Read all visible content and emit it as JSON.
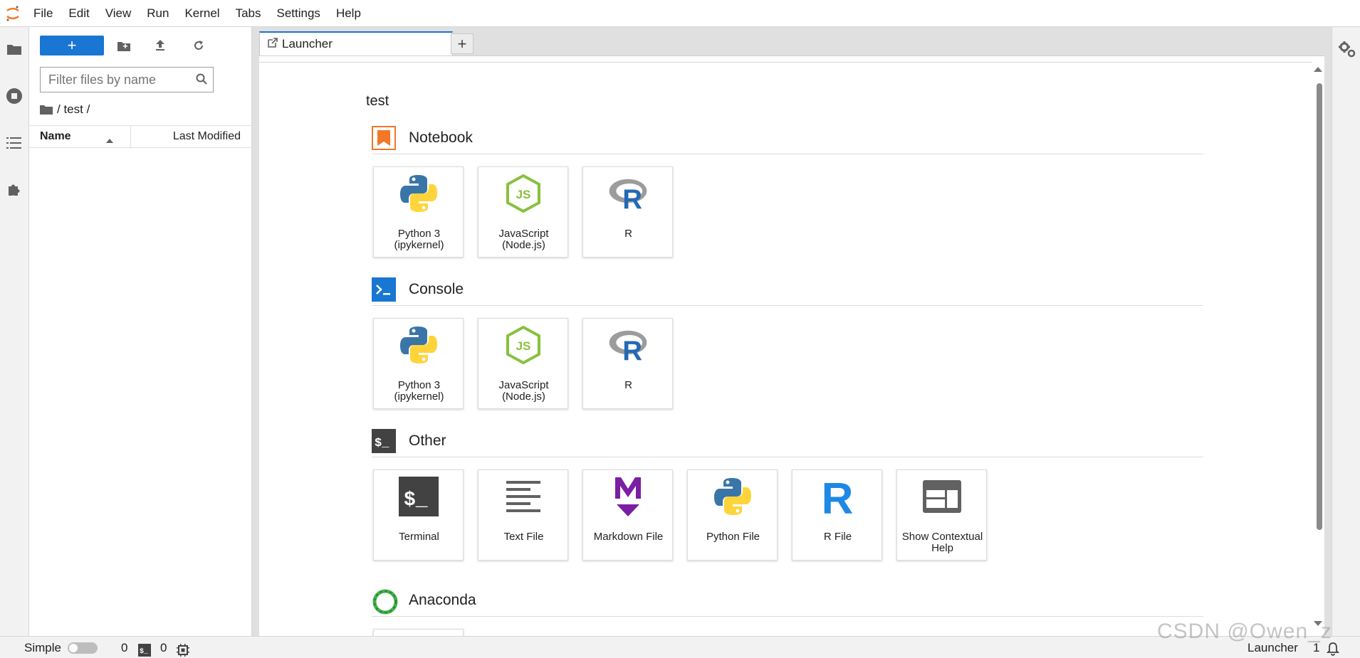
{
  "menubar": {
    "items": [
      "File",
      "Edit",
      "View",
      "Run",
      "Kernel",
      "Tabs",
      "Settings",
      "Help"
    ]
  },
  "filebrowser": {
    "new_label": "+",
    "filter_placeholder": "Filter files by name",
    "breadcrumb": "/ test /",
    "columns": {
      "name": "Name",
      "modified": "Last Modified"
    }
  },
  "tabs": [
    {
      "label": "Launcher"
    }
  ],
  "add_tab_label": "+",
  "launcher": {
    "cwd": "test",
    "sections": [
      {
        "title": "Notebook",
        "items": [
          "Python 3 (ipykernel)",
          "JavaScript (Node.js)",
          "R"
        ]
      },
      {
        "title": "Console",
        "items": [
          "Python 3 (ipykernel)",
          "JavaScript (Node.js)",
          "R"
        ]
      },
      {
        "title": "Other",
        "items": [
          "Terminal",
          "Text File",
          "Markdown File",
          "Python File",
          "R File",
          "Show Contextual Help"
        ]
      },
      {
        "title": "Anaconda",
        "items": []
      }
    ]
  },
  "statusbar": {
    "mode": "Simple",
    "kernels": "0",
    "terminals": "0",
    "active": "Launcher",
    "count": "1"
  },
  "watermark": "CSDN @Owen_z",
  "colors": {
    "accent": "#1976d2",
    "notebook": "#f37726",
    "python_blue": "#3a75a8",
    "python_yellow": "#ffd43b",
    "js_green": "#89c03d",
    "r_blue": "#2469b3",
    "markdown": "#7b1fa2",
    "anaconda": "#43b049"
  }
}
